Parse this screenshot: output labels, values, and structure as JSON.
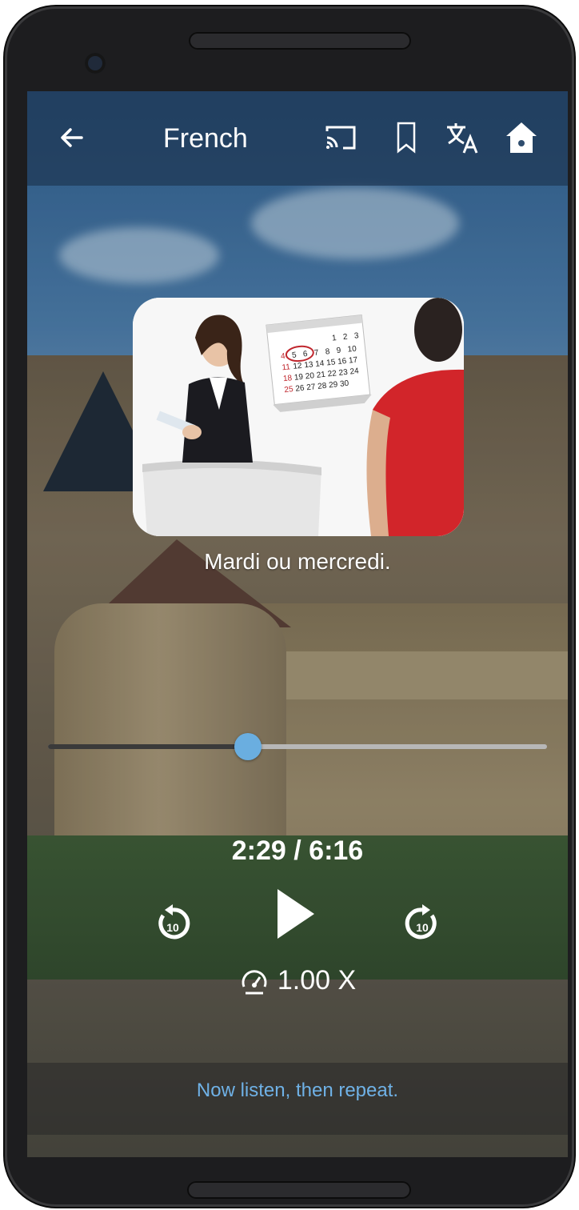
{
  "toolbar": {
    "title": "French",
    "icons": [
      "back-arrow-icon",
      "cast-icon",
      "bookmark-icon",
      "translate-icon",
      "home-icon"
    ]
  },
  "lesson": {
    "caption": "Mardi ou mercredi.",
    "image": "receptionist-calendar-customer"
  },
  "player": {
    "time": "2:29 / 6:16",
    "progress": 0.4,
    "speed": "1.00 X",
    "rewind_label": "10",
    "forward_label": "10"
  },
  "footer": {
    "hint": "Now listen, then repeat."
  },
  "colors": {
    "accent": "#6aaee0",
    "hint_text": "#6fb1e6"
  }
}
